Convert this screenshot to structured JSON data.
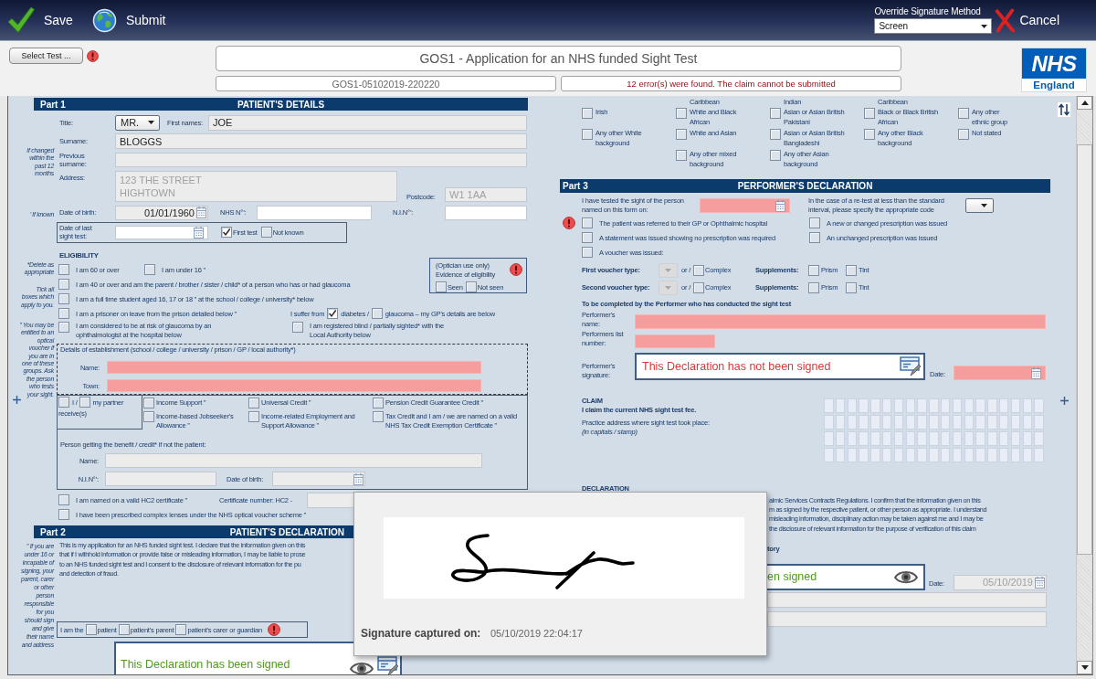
{
  "toolbar": {
    "actions": [
      {
        "kind": "save",
        "label": "Save"
      },
      {
        "kind": "submit",
        "label": "Submit"
      }
    ],
    "override": {
      "label": "Override Signature Method",
      "value": "Screen"
    },
    "cancel": {
      "label": "Cancel"
    }
  },
  "header": {
    "select_test": {
      "label": "Select Test ...",
      "error": true
    },
    "title": "GOS1 - Application for an NHS funded Sight Test",
    "reference": "GOS1-05102019-220220",
    "status": "12 error(s) were found. The claim cannot be submitted",
    "logo": {
      "mark": "NHS",
      "region": "England"
    }
  },
  "part1": {
    "part": "Part 1",
    "heading": "PATIENT'S DETAILS",
    "notes": [
      "If changed within the past 12 months",
      "’ If known",
      "*Delete as appropriate",
      "Tick all boxes which apply to you.",
      "” You may be entitled to an optical voucher if you are in one of these groups. Ask the person who tests your sight."
    ],
    "title": {
      "label": "Title:",
      "value": "MR."
    },
    "first_names": {
      "label": "First names:",
      "value": "JOE",
      "readonly": true
    },
    "surname": {
      "label": "Surname:",
      "value": "BLOGGS",
      "readonly": true
    },
    "previous_surname": {
      "label": "Previous surname:",
      "readonly": true
    },
    "address": {
      "label": "Address:",
      "lines": [
        "123 THE STREET",
        "HIGHTOWN"
      ],
      "disabled": true
    },
    "postcode": {
      "label": "Postcode:",
      "value": "W1 1AA",
      "disabled": true
    },
    "date_of_birth": {
      "label": "Date of birth:",
      "value": "01/01/1960",
      "readonly": true
    },
    "nhs_number": {
      "label": "NHS N°’:",
      "readonly": false
    },
    "nin": {
      "label": "N.I.N°’:",
      "readonly": false
    },
    "last_sight_test": {
      "label": "Date of last sight test:",
      "readonly": false,
      "options": [
        {
          "label": "First test",
          "checked": true
        },
        {
          "label": "Not known",
          "checked": false
        }
      ]
    },
    "eligibility": {
      "heading": "ELIGIBILITY",
      "items": [
        {
          "kind": "checkbox",
          "label": "I am 60 or over",
          "checked": false
        },
        {
          "kind": "checkbox",
          "label": "I am under 16 ”",
          "checked": false
        },
        {
          "kind": "checkbox",
          "label": "I am 40 or over and am the parent / brother / sister / child* of a person who has or had glaucoma",
          "checked": false
        },
        {
          "kind": "checkbox",
          "label": "I am a full time student aged 16, 17 or 18 ” at the school / college / university* below",
          "checked": false
        },
        {
          "kind": "checkbox",
          "label": "I am a prisoner on leave from the prison detailed below ”",
          "checked": false
        },
        {
          "kind": "inline",
          "prefix": "I suffer from",
          "options": [
            {
              "label": "diabetes /",
              "checked": true
            },
            {
              "label": "glaucoma – my GP's details are below",
              "checked": false
            }
          ]
        },
        {
          "kind": "checkbox",
          "label": "I am considered to be at risk of glaucoma by an ophthalmologist at the hospital below",
          "checked": false
        },
        {
          "kind": "checkbox",
          "label": "I am registered blind / partially sighted* with the Local Authority below",
          "checked": false
        }
      ]
    },
    "optician": {
      "lines": [
        "(Optician use only)",
        "Evidence of eligibility"
      ],
      "error": true,
      "options": [
        {
          "label": "Seen",
          "checked": false
        },
        {
          "label": "Not seen",
          "checked": false
        }
      ]
    },
    "establishment": {
      "label": "Details of establishment (school / college / university / prison / GP / local authority*)",
      "fields": [
        {
          "label": "Name:",
          "invalid": true
        },
        {
          "label": "Town:",
          "invalid": true
        }
      ]
    },
    "benefits": {
      "receivers": {
        "options": [
          {
            "label": "I /",
            "checked": false
          },
          {
            "label": "my partner",
            "checked": false
          }
        ],
        "suffix": "receive(s)"
      },
      "columns": [
        [
          {
            "label": "Income Support ”",
            "checked": false
          },
          {
            "label": "Income-based Jobseeker's Allowance ”",
            "checked": false
          }
        ],
        [
          {
            "label": "Universal Credit ”",
            "checked": false
          },
          {
            "label": "Income-related Employment and Support Allowance ”",
            "checked": false
          }
        ],
        [
          {
            "label": "Pension Credit Guarantee Credit ”",
            "checked": false
          },
          {
            "label": "Tax Credit and I am / we are named on a valid NHS Tax Credit Exemption Certificate ”",
            "checked": false
          }
        ]
      ],
      "person": {
        "label": "Person getting the benefit / credit* if not the patient:",
        "fields": [
          {
            "kind": "text",
            "label": "Name:",
            "readonly": true
          },
          {
            "kind": "text",
            "label": "N.I.N°’:",
            "readonly": true
          },
          {
            "kind": "date",
            "label": "Date of birth:",
            "readonly": true
          }
        ]
      }
    },
    "hc2": {
      "label": "I am named on a valid HC2 certificate ”",
      "checked": false,
      "number": {
        "label": "Certificate number: HC2 -",
        "readonly": true
      }
    },
    "complex_lenses": {
      "label": "I have been prescribed complex lenses under the NHS optical voucher scheme ”",
      "checked": false
    }
  },
  "part2": {
    "part": "Part 2",
    "heading": "PATIENT'S DECLARATION",
    "note": "” If you are under 16 or incapable of signing, your parent, carer or other person responsible for you should sign and give their name and address",
    "lines": [
      "This is my application for an NHS funded sight test. I declare that the information given on this",
      "that if I withhold information or provide false or misleading information, I may be liable to prose",
      "to an NHS funded sight test and I consent to the disclosure of relevant information for the pu",
      "and detection of fraud."
    ],
    "signer": {
      "label": "I am the",
      "options": [
        {
          "label": "patient",
          "checked": false
        },
        {
          "label": "patient's parent",
          "checked": false
        },
        {
          "label": "patient's carer or guardian",
          "checked": false
        }
      ],
      "error": true
    },
    "signature": {
      "text": "This Declaration has been signed",
      "signed": true,
      "editable": true
    }
  },
  "ethnicity": {
    "columns": [
      {
        "items": [
          {
            "label": "Irish",
            "checked": false
          },
          {
            "label": "Any other White background",
            "checked": false
          }
        ]
      },
      {
        "tail": "Caribbean",
        "items": [
          {
            "label": "White and Black African",
            "checked": false
          },
          {
            "label": "White and Asian",
            "checked": false
          },
          {
            "label": "Any other mixed background",
            "checked": false
          }
        ]
      },
      {
        "tail": "Indian",
        "items": [
          {
            "label": "Asian or Asian British Pakistani",
            "checked": false
          },
          {
            "label": "Asian or Asian British Bangladeshi",
            "checked": false
          },
          {
            "label": "Any other Asian background",
            "checked": false
          }
        ]
      },
      {
        "tail": "Caribbean",
        "items": [
          {
            "label": "Black or Black British African",
            "checked": false
          },
          {
            "label": "Any other Black background",
            "checked": false
          }
        ]
      },
      {
        "items": [
          {
            "label": "Any other ethnic group",
            "checked": false
          },
          {
            "label": "Not stated",
            "checked": false
          }
        ]
      }
    ]
  },
  "part3": {
    "part": "Part 3",
    "heading": "PERFORMER'S DECLARATION",
    "tested": {
      "label": "I have tested the sight of the person named on this form on:",
      "invalid": true
    },
    "retest": {
      "label": "In the case of a re-test at less than the standard interval, please specify the appropriate code"
    },
    "outcomes_error": true,
    "outcomes": [
      [
        {
          "label": "The patient was referred to their GP or Ophthalmic hospital",
          "checked": false
        },
        {
          "label": "A new or changed prescription was issued",
          "checked": false
        }
      ],
      [
        {
          "label": "A statement was issued showing no prescription was required",
          "checked": false
        },
        {
          "label": "An unchanged prescription was issued",
          "checked": false
        }
      ],
      [
        {
          "label": "A voucher was issued:",
          "checked": false
        }
      ]
    ],
    "vouchers": [
      {
        "label": "First voucher type:",
        "type_disabled": true,
        "or": "or /",
        "complex": {
          "label": "Complex",
          "checked": false
        },
        "supplements": "Supplements:",
        "options": [
          {
            "label": "Prism",
            "checked": false
          },
          {
            "label": "Tint",
            "checked": false
          }
        ]
      },
      {
        "label": "Second voucher type:",
        "type_disabled": true,
        "or": "or /",
        "complex": {
          "label": "Complex",
          "checked": false
        },
        "supplements": "Supplements:",
        "options": [
          {
            "label": "Prism",
            "checked": false
          },
          {
            "label": "Tint",
            "checked": false
          }
        ]
      }
    ],
    "performer_heading": "To be completed by the Performer who has conducted the sight test",
    "performer_name": {
      "label": "Performer's name:",
      "invalid": true
    },
    "list_number": {
      "label": "Performers list number:",
      "invalid": true
    },
    "signature": {
      "label": "Performer's signature:",
      "text": "This Declaration has not been signed",
      "signed": false,
      "editable": true
    },
    "date": {
      "label": "Date:",
      "invalid": true
    }
  },
  "claim": {
    "heading": "CLAIM",
    "statement": "I claim the current NHS sight test fee.",
    "address_label": "Practice address where sight test took place:",
    "hint": "(in capitals / stamp)"
  },
  "declaration": {
    "heading": "DECLARATION",
    "lines": [
      "almic Services Contracts Regulations. I confirm that the information given on this",
      "m as signed by the respective patient, or other person as appropriate. I understand",
      "misleading information, disciplinary action may be taken against me and I may be",
      "the disclosure of relevant information for the purpose of verification of this claim"
    ],
    "signatory": "tory",
    "signature": {
      "text": "en signed",
      "signed": true,
      "editable": false
    },
    "date": {
      "label": "Date:",
      "value": "05/10/2019",
      "disabled": true
    },
    "fields": [
      {
        "readonly": true
      },
      {
        "readonly": true
      }
    ]
  },
  "signature_popup": {
    "label": "Signature captured on:",
    "captured": "05/10/2019 22:04:17"
  }
}
